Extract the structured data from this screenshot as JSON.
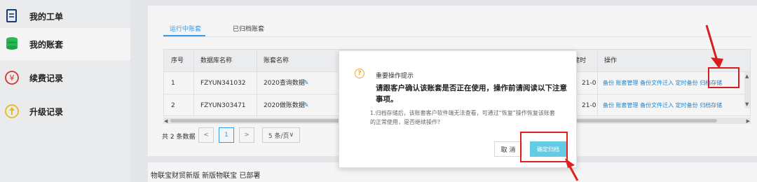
{
  "sidebar": {
    "items": [
      {
        "label": "我的工单",
        "icon": "document-icon"
      },
      {
        "label": "我的账套",
        "icon": "database-icon"
      },
      {
        "label": "续费记录",
        "icon": "yen-icon"
      },
      {
        "label": "升级记录",
        "icon": "upgrade-icon"
      }
    ]
  },
  "tabs": [
    {
      "label": "运行中账套"
    },
    {
      "label": "已归档账套"
    }
  ],
  "table": {
    "headers": [
      "序号",
      "数据库名称",
      "账套名称",
      "建时",
      "操作"
    ],
    "rows": [
      {
        "index": "1",
        "db": "FZYUN341032",
        "name": "2020查询数据",
        "date": "21-0",
        "ops": [
          "备份",
          "账套管理",
          "备份文件迁入",
          "定时备份",
          "归档存储"
        ]
      },
      {
        "index": "2",
        "db": "FZYUN303471",
        "name": "2020做账数据",
        "date": "21-0",
        "ops": [
          "备份",
          "账套管理",
          "备份文件迁入",
          "定时备份",
          "归档存储"
        ]
      }
    ]
  },
  "pagination": {
    "total": "共 2 条数据",
    "current": "1",
    "page_size": "5 条/页"
  },
  "bottom_bar": {
    "text": "物联宝财贸新版   新版物联宝   已部署"
  },
  "dialog": {
    "title": "重要操作提示",
    "message": "请跟客户确认该账套是否正在使用，操作前请阅读以下注意事项。",
    "note": "1.归档存储后，该账套客户软件端无法查看，可通过“恢复”操作恢复该账套的正常使用，是否继续操作?",
    "cancel_label": "取 消",
    "confirm_label": "确定归档"
  },
  "colors": {
    "accent": "#36a3f7",
    "link": "#1d8ce0",
    "highlight": "#e02020",
    "confirm_button": "#63cbe3",
    "warning": "#f0a83a"
  }
}
